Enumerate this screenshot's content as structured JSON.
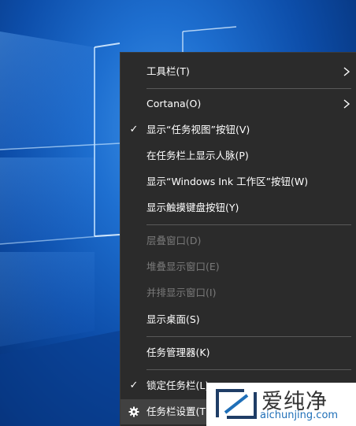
{
  "menu": {
    "items": [
      {
        "label": "工具栏(T)",
        "has_submenu": true,
        "checked": false,
        "enabled": true
      },
      {
        "label": "Cortana(O)",
        "has_submenu": true,
        "checked": false,
        "enabled": true
      },
      {
        "label": "显示“任务视图”按钮(V)",
        "has_submenu": false,
        "checked": true,
        "enabled": true
      },
      {
        "label": "在任务栏上显示人脉(P)",
        "has_submenu": false,
        "checked": false,
        "enabled": true
      },
      {
        "label": "显示“Windows Ink 工作区”按钮(W)",
        "has_submenu": false,
        "checked": false,
        "enabled": true
      },
      {
        "label": "显示触摸键盘按钮(Y)",
        "has_submenu": false,
        "checked": false,
        "enabled": true
      },
      {
        "label": "层叠窗口(D)",
        "has_submenu": false,
        "checked": false,
        "enabled": false
      },
      {
        "label": "堆叠显示窗口(E)",
        "has_submenu": false,
        "checked": false,
        "enabled": false
      },
      {
        "label": "并排显示窗口(I)",
        "has_submenu": false,
        "checked": false,
        "enabled": false
      },
      {
        "label": "显示桌面(S)",
        "has_submenu": false,
        "checked": false,
        "enabled": true
      },
      {
        "label": "任务管理器(K)",
        "has_submenu": false,
        "checked": false,
        "enabled": true
      },
      {
        "label": "锁定任务栏(L)",
        "has_submenu": false,
        "checked": true,
        "enabled": true
      },
      {
        "label": "任务栏设置(T)",
        "has_submenu": false,
        "checked": false,
        "enabled": true,
        "icon": "gear-icon"
      }
    ],
    "check_glyph": "✓"
  },
  "watermark": {
    "brand": "爱纯净",
    "url": "aichunjing.com"
  },
  "colors": {
    "menu_bg": "#2b2b2b",
    "menu_text": "#ffffff",
    "disabled_text": "#7a7a7a",
    "separator": "#595959"
  }
}
